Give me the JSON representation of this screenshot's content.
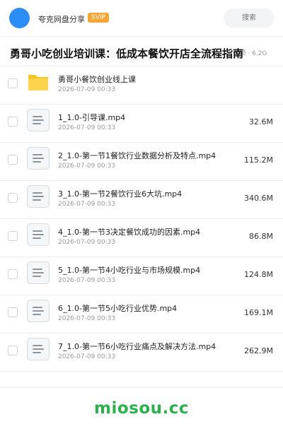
{
  "header": {
    "app_name": "夸克网盘分享",
    "badge": "SVIP",
    "search_placeholder": "搜索",
    "avatar_color": "#2b8df5",
    "badge_color": "#f7a636"
  },
  "share": {
    "title": "勇哥小吃创业培训课：低成本餐饮开店全流程指南",
    "meta": "8 项 · 6.2G"
  },
  "files": [
    {
      "name": "勇哥小餐饮创业线上课",
      "date": "2026-07-09 00:33",
      "size": "",
      "type": "folder-icon"
    },
    {
      "name": "1_1.0-引导课.mp4",
      "date": "2026-07-09 00:33",
      "size": "32.6M",
      "type": "video-file-icon"
    },
    {
      "name": "2_1.0-第一节1餐饮行业数据分析及特点.mp4",
      "date": "2026-07-09 00:33",
      "size": "115.2M",
      "type": "video-file-icon"
    },
    {
      "name": "3_1.0-第一节2餐饮行业6大坑.mp4",
      "date": "2026-07-09 00:33",
      "size": "340.6M",
      "type": "video-file-icon"
    },
    {
      "name": "4_1.0-第一节3决定餐饮成功的因素.mp4",
      "date": "2026-07-09 00:33",
      "size": "86.8M",
      "type": "video-file-icon"
    },
    {
      "name": "5_1.0-第一节4小吃行业与市场规模.mp4",
      "date": "2026-07-09 00:33",
      "size": "124.8M",
      "type": "video-file-icon"
    },
    {
      "name": "6_1.0-第一节5小吃行业优势.mp4",
      "date": "2026-07-09 00:33",
      "size": "169.1M",
      "type": "video-file-icon"
    },
    {
      "name": "7_1.0-第一节6小吃行业痛点及解决方法.mp4",
      "date": "2026-07-09 00:33",
      "size": "262.9M",
      "type": "video-file-icon"
    }
  ],
  "watermark": {
    "text": "miosou.cc",
    "color": "#2bb24c"
  }
}
